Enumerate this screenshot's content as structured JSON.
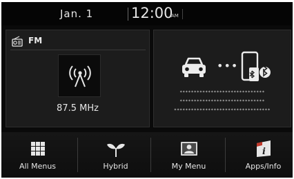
{
  "status": {
    "date": "Jan.  1",
    "time": "12:00",
    "ampm": "AM"
  },
  "radio": {
    "band": "FM",
    "frequency": "87.5 MHz"
  },
  "connection": {
    "dots": "•••",
    "masked_lines": [
      "******************************",
      "******************************",
      "**********************************"
    ]
  },
  "menu": {
    "items": [
      {
        "label": "All Menus",
        "icon": "grid-icon"
      },
      {
        "label": "Hybrid",
        "icon": "sprout-icon"
      },
      {
        "label": "My Menu",
        "icon": "person-icon"
      },
      {
        "label": "Apps/Info",
        "icon": "info-icon"
      }
    ]
  }
}
